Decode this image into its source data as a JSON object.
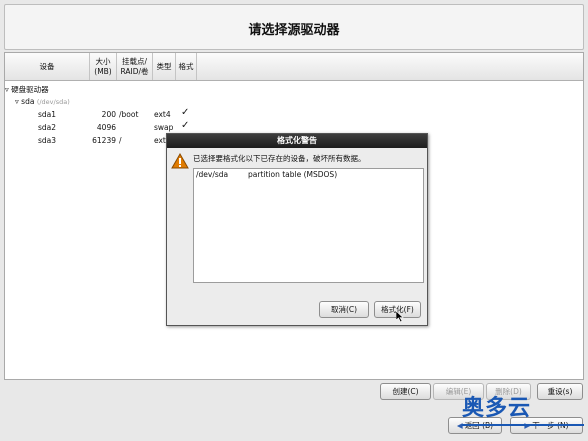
{
  "page": {
    "title": "请选择源驱动器"
  },
  "table": {
    "headers": {
      "device": "设备",
      "size": "大小\n(MB)",
      "mount": "挂载点/\nRAID/卷",
      "type": "类型",
      "format": "格式"
    },
    "group_label": "硬盘驱动器",
    "disk": {
      "name": "sda",
      "path": "(/dev/sda)"
    },
    "rows": [
      {
        "device": "sda1",
        "size": "200",
        "mount": "/boot",
        "type": "ext4",
        "format": "✓"
      },
      {
        "device": "sda2",
        "size": "4096",
        "mount": "",
        "type": "swap",
        "format": "✓"
      },
      {
        "device": "sda3",
        "size": "61239",
        "mount": "/",
        "type": "ext",
        "format": ""
      }
    ]
  },
  "dialog": {
    "title": "格式化警告",
    "message": "已选择要格式化以下已存在的设备，破坏所有数据。",
    "items": [
      {
        "device": "/dev/sda",
        "description": "partition table (MSDOS)"
      }
    ],
    "cancel_label": "取消(C)",
    "format_label": "格式化(F)",
    "icon": "warning-icon"
  },
  "actions": {
    "create": "创建(C)",
    "edit": "编辑(E)",
    "delete": "删除(D)",
    "reset": "重设(s)"
  },
  "nav": {
    "back": "返回 (B)",
    "next": "下一步 (N)"
  },
  "watermark": "奥多云",
  "colors": {
    "accent": "#1a58b4",
    "warning": "#e07b00"
  }
}
